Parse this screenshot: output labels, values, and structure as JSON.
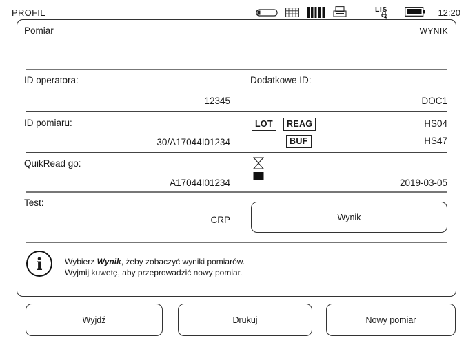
{
  "status_bar": {
    "title": "PROFIL",
    "lis_label": "LIS",
    "time": "12:20",
    "icons": [
      "cartridge-icon",
      "keyboard-icon",
      "barcode-icon",
      "printer-icon",
      "lis-icon",
      "battery-icon"
    ]
  },
  "panel": {
    "title": "Pomiar",
    "mode": "WYNIK"
  },
  "fields": {
    "operator_id": {
      "label": "ID operatora:",
      "value": "12345"
    },
    "extra_id": {
      "label": "Dodatkowe ID:",
      "value": "DOC1"
    },
    "measurement_id": {
      "label": "ID pomiaru:",
      "value": "30/A17044I01234"
    },
    "lot": {
      "lot_label": "LOT",
      "reag_label": "REAG",
      "reag_value": "HS04",
      "buf_label": "BUF",
      "buf_value": "HS47"
    },
    "device": {
      "label": "QuikRead go:",
      "value": "A17044I01234"
    },
    "expiry": {
      "value": "2019-03-05"
    },
    "test": {
      "label": "Test:",
      "value": "CRP"
    }
  },
  "buttons": {
    "result": "Wynik",
    "exit": "Wyjdź",
    "print": "Drukuj",
    "new_measurement": "Nowy pomiar"
  },
  "info": {
    "line1_prefix": "Wybierz ",
    "line1_bold": "Wynik",
    "line1_suffix": ", żeby zobaczyć wyniki pomiarów.",
    "line2": "Wyjmij kuwetę, aby przeprowadzić nowy pomiar."
  }
}
